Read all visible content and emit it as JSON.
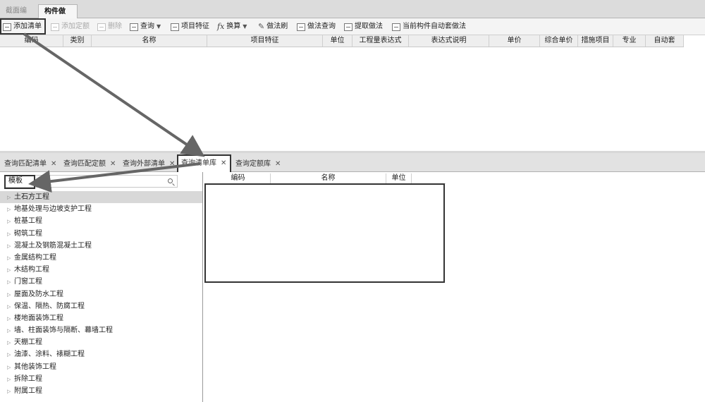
{
  "top_tabs": [
    "截面编辑",
    "构件做法"
  ],
  "toolbar": {
    "add_list": "添加清单",
    "add_quota": "添加定额",
    "delete": "删除",
    "query": "查询",
    "item_feature": "项目特征",
    "conversion": "换算",
    "method_brush": "做法刷",
    "method_query": "做法查询",
    "extract_method": "提取做法",
    "auto_apply": "当前构件自动套做法",
    "fx_glyph": "fx"
  },
  "grid_columns": [
    "编码",
    "类别",
    "名称",
    "项目特征",
    "单位",
    "工程量表达式",
    "表达式说明",
    "单价",
    "综合单价",
    "措施项目",
    "专业",
    "自动套"
  ],
  "bottom_tabs": [
    {
      "label": "查询匹配清单"
    },
    {
      "label": "查询匹配定额"
    },
    {
      "label": "查询外部清单"
    },
    {
      "label": "查询清单库",
      "active": true
    },
    {
      "label": "查询定额库"
    }
  ],
  "search": {
    "value": "模板"
  },
  "tree_items": [
    "土石方工程",
    "地基处理与边坡支护工程",
    "桩基工程",
    "砌筑工程",
    "混凝土及钢筋混凝土工程",
    "金属结构工程",
    "木结构工程",
    "门窗工程",
    "屋面及防水工程",
    "保温、隔热、防腐工程",
    "楼地面装饰工程",
    "墙、柱面装饰与隔断、幕墙工程",
    "天棚工程",
    "油漆、涂料、裱糊工程",
    "其他装饰工程",
    "拆除工程",
    "附属工程"
  ],
  "result_columns": [
    "编码",
    "名称",
    "单位"
  ],
  "colors": {
    "highlight_border": "#333333",
    "arrow": "#666666"
  }
}
